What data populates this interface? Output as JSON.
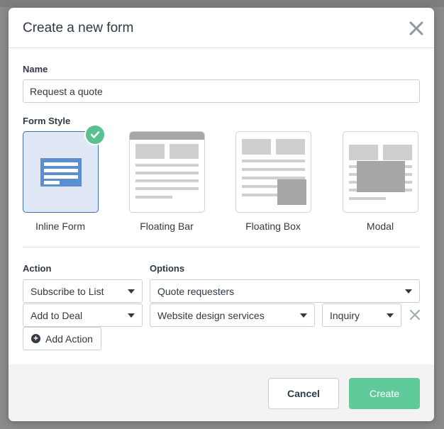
{
  "modal": {
    "title": "Create a new form",
    "close_icon": "close-icon"
  },
  "name": {
    "label": "Name",
    "value": "Request a quote"
  },
  "form_style": {
    "label": "Form Style",
    "selected": "Inline Form",
    "options": [
      {
        "label": "Inline Form",
        "icon": "inline-form-icon"
      },
      {
        "label": "Floating Bar",
        "icon": "floating-bar-icon"
      },
      {
        "label": "Floating Box",
        "icon": "floating-box-icon"
      },
      {
        "label": "Modal",
        "icon": "modal-icon"
      }
    ]
  },
  "actions": {
    "action_label": "Action",
    "options_label": "Options",
    "rows": [
      {
        "action": "Subscribe to List",
        "option": "Quote requesters"
      },
      {
        "action": "Add to Deal",
        "option": "Website design services",
        "sub_option": "Inquiry"
      }
    ],
    "add_action_label": "Add Action"
  },
  "footer": {
    "cancel_label": "Cancel",
    "create_label": "Create"
  },
  "colors": {
    "accent_green": "#5fcb9b",
    "selected_blue": "#3f6fa8",
    "text": "#2f3a44"
  }
}
